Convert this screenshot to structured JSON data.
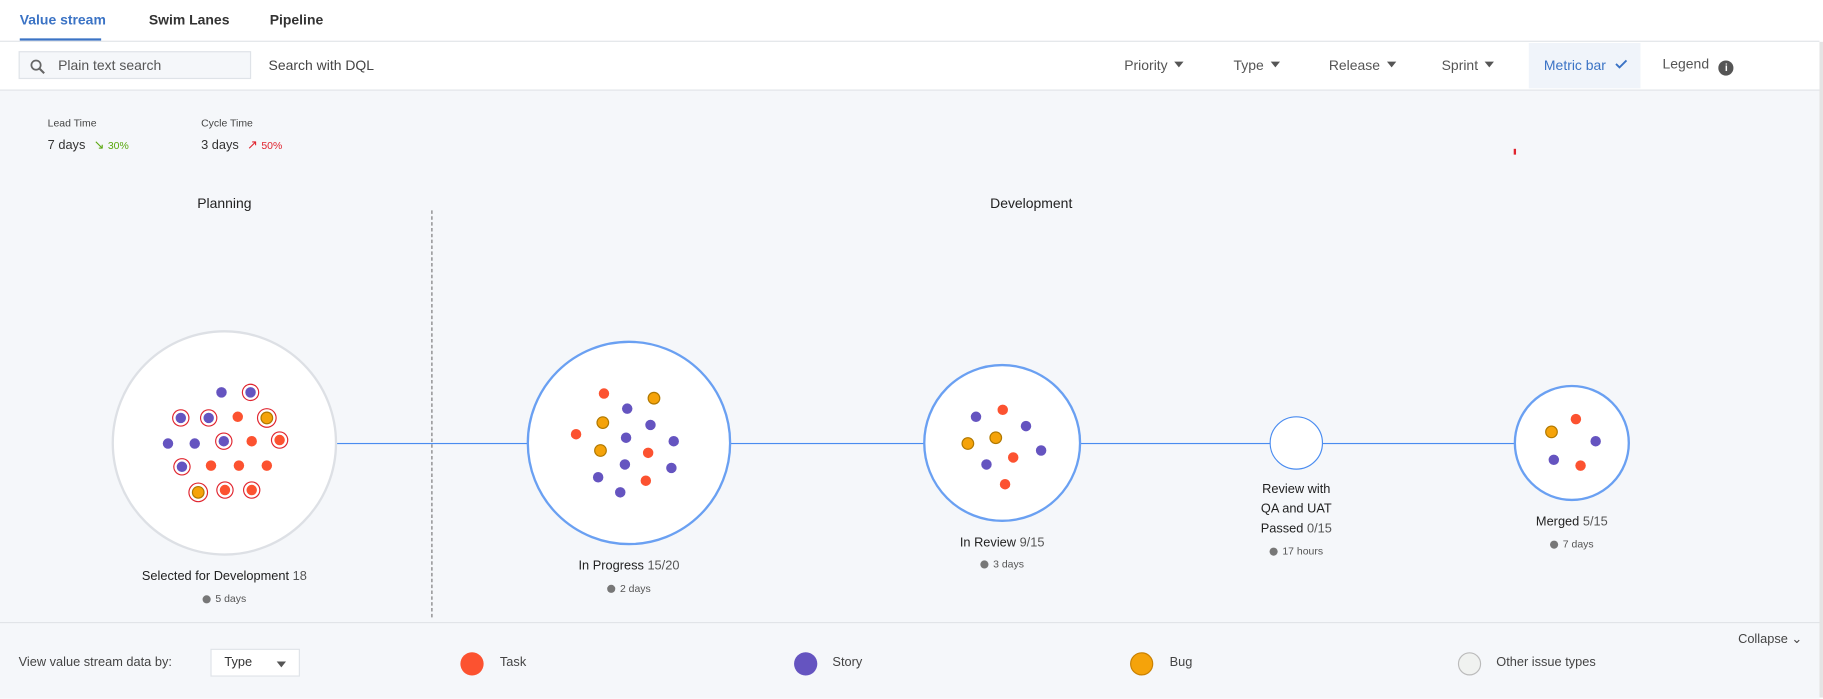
{
  "tabs": [
    {
      "label": "Value stream",
      "active": true
    },
    {
      "label": "Swim Lanes"
    },
    {
      "label": "Pipeline"
    }
  ],
  "toolbar": {
    "search_placeholder": "Plain text search",
    "dql_label": "Search with DQL",
    "filters": [
      "Priority",
      "Type",
      "Release",
      "Sprint"
    ],
    "metric_bar": "Metric bar",
    "legend": "Legend"
  },
  "metrics": [
    {
      "label": "Lead Time",
      "value": "7 days",
      "change": "30%",
      "trend": "down",
      "color": "#5aa80f"
    },
    {
      "label": "Cycle Time",
      "value": "3 days",
      "change": "50%",
      "trend": "up",
      "color": "#e0242e"
    }
  ],
  "phases": [
    "Planning",
    "Development"
  ],
  "colors": {
    "task": "#fc5230",
    "story": "#6554c0",
    "bug": "#f5a30a",
    "accent": "#4a8cf0",
    "ring": "#e0242e"
  },
  "stages": [
    {
      "name": "Selected for Development",
      "count": "18",
      "duration": "5 days"
    },
    {
      "name": "In Progress",
      "count": "15/20",
      "duration": "2 days"
    },
    {
      "name": "In Review",
      "count": "9/15",
      "duration": "3 days"
    },
    {
      "name_lines": [
        "Review with",
        "QA and UAT",
        "Passed"
      ],
      "count": "0/15",
      "duration": "17 hours"
    },
    {
      "name": "Merged",
      "count": "5/15",
      "duration": "7 days"
    }
  ],
  "footer": {
    "view_by_label": "View value stream data by:",
    "view_by_value": "Type",
    "collapse": "Collapse",
    "legend": [
      {
        "label": "Task"
      },
      {
        "label": "Story"
      },
      {
        "label": "Bug"
      },
      {
        "label": "Other issue types"
      }
    ]
  }
}
